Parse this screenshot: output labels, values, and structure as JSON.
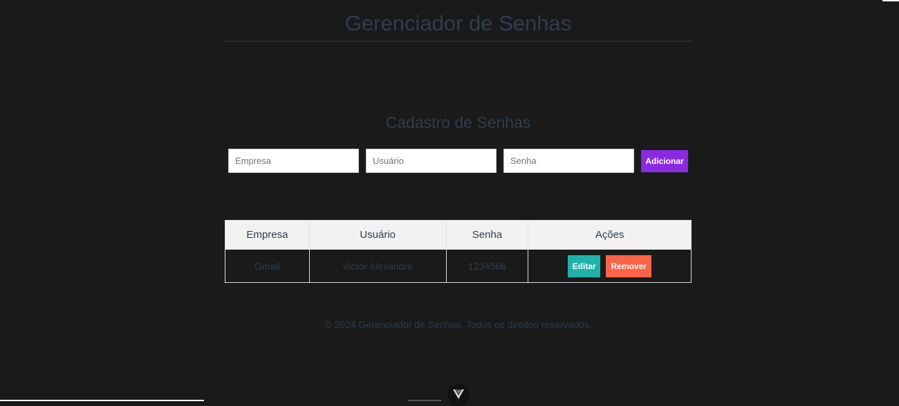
{
  "header": {
    "title": "Gerenciador de Senhas"
  },
  "form": {
    "title": "Cadastro de Senhas",
    "empresa_placeholder": "Empresa",
    "usuario_placeholder": "Usuário",
    "senha_placeholder": "Senha",
    "add_label": "Adicionar"
  },
  "table": {
    "headers": [
      "Empresa",
      "Usuário",
      "Senha",
      "Ações"
    ],
    "rows": [
      {
        "empresa": "Gmail",
        "usuario": "Victor Alexandre",
        "senha": "1234566",
        "edit_label": "Editar",
        "remove_label": "Remover"
      }
    ]
  },
  "footer": {
    "text": "© 2024 Gerenciador de Senhas. Todos os direitos reservados."
  },
  "colors": {
    "background": "#1a1a1a",
    "text": "#2c3e50",
    "add": "#8a2be2",
    "edit": "#20b2aa",
    "remove": "#ff6347"
  },
  "icons": {
    "devtools": "vue-logo-icon"
  }
}
